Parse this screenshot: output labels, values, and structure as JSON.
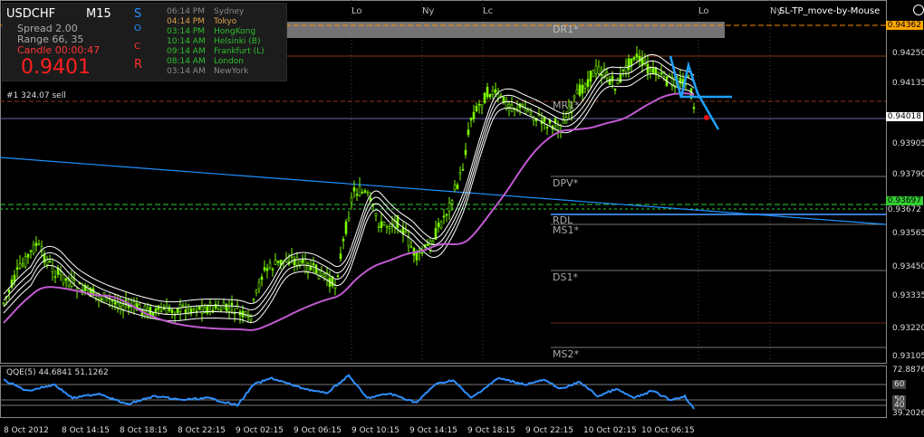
{
  "symbol_panel": {
    "symbol": "USDCHF",
    "timeframe": "M15",
    "spread": "Spread  2.00",
    "range": "Range   66, 35",
    "candle": "Candle  00:00:47",
    "price": "0.9401",
    "letters": [
      "S",
      "O",
      "C",
      "R"
    ]
  },
  "sessions": [
    {
      "time": "06:14 PM",
      "name": "Sydney",
      "state": "off"
    },
    {
      "time": "04:14 PM",
      "name": "Tokyo",
      "state": "on"
    },
    {
      "time": "03:14 PM",
      "name": "HongKong",
      "state": "green"
    },
    {
      "time": "10:14 AM",
      "name": "Helsinki  (B)",
      "state": "green"
    },
    {
      "time": "09:14 AM",
      "name": "Frankfurt  (L)",
      "state": "green"
    },
    {
      "time": "08:14 AM",
      "name": "London",
      "state": "green"
    },
    {
      "time": "03:14 AM",
      "name": "NewYork",
      "state": "off"
    }
  ],
  "session_markers": [
    "Lo",
    "Ny",
    "Lc",
    "Lo",
    "Ny"
  ],
  "ea_label": "SL-TP_move-by-Mouse",
  "trade_line": "#1  324.07 sell",
  "pivots": {
    "r1": "DR1*",
    "mr": "MR1*",
    "dpv": "DPV*",
    "rdl": "RDL",
    "ms1": "MS1*",
    "ds1": "DS1*",
    "ms2": "MS2*"
  },
  "price_axis": [
    "0.94362",
    "0.94250",
    "0.94135",
    "0.94018",
    "0.93905",
    "0.93790",
    "0.93697",
    "0.93565",
    "0.93450",
    "0.93335",
    "0.93220",
    "0.93105"
  ],
  "price_tags": {
    "top": "0.94362",
    "current": "0.94018",
    "green": "0.93697",
    "under_green": "0.93672"
  },
  "qqe": {
    "title": "QQE(5) 44.6841 51.1262",
    "axis": [
      "72.8876",
      "60",
      "50",
      "40",
      "39.2026"
    ]
  },
  "time_axis": [
    "8 Oct 2012",
    "8 Oct 14:15",
    "8 Oct 18:15",
    "8 Oct 22:15",
    "9 Oct 02:15",
    "9 Oct 06:15",
    "9 Oct 10:15",
    "9 Oct 14:15",
    "9 Oct 18:15",
    "9 Oct 22:15",
    "10 Oct 02:15",
    "10 Oct 06:15"
  ],
  "colors": {
    "candle": "#7CFC00",
    "ema": "#ffffff",
    "ma": "#c05ad0",
    "trend": "#1e90ff",
    "qqe": "#2f8fff",
    "price_tag_current": "#ffffff",
    "price_tag_green": "#32cd32",
    "price_tag_top": "#ffa500"
  }
}
